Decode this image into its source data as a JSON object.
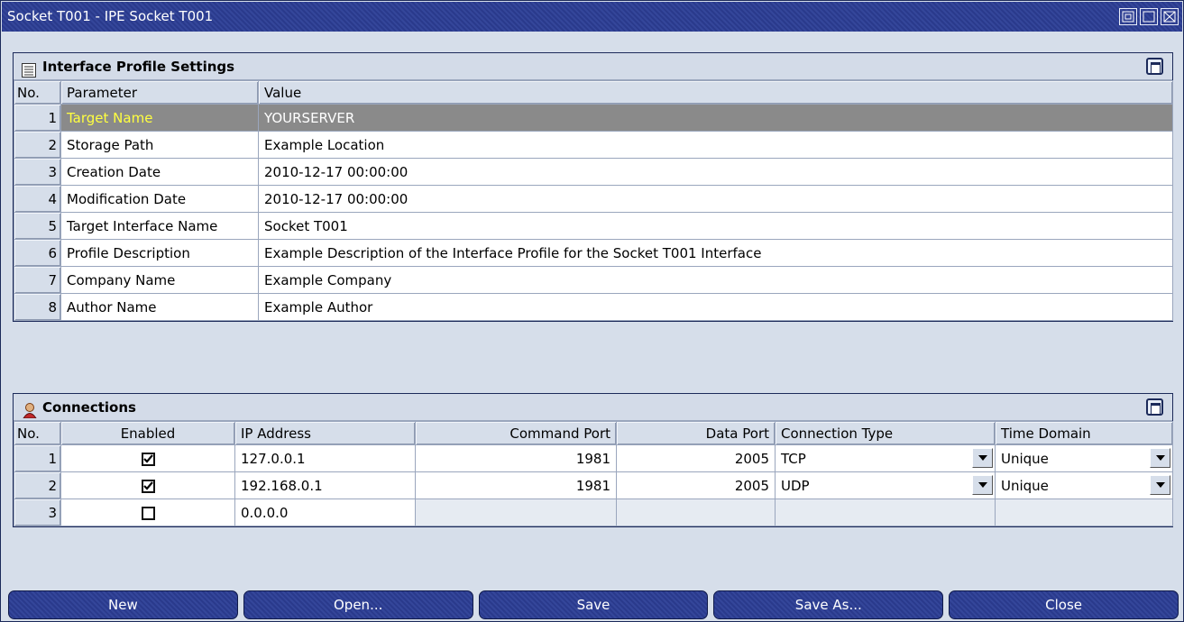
{
  "window": {
    "title": "Socket T001 - IPE Socket T001"
  },
  "profile": {
    "title": "Interface Profile Settings",
    "headers": {
      "no": "No.",
      "parameter": "Parameter",
      "value": "Value"
    },
    "rows": [
      {
        "no": "1",
        "parameter": "Target Name",
        "value": "YOURSERVER"
      },
      {
        "no": "2",
        "parameter": "Storage Path",
        "value": "Example Location"
      },
      {
        "no": "3",
        "parameter": "Creation Date",
        "value": "2010-12-17 00:00:00"
      },
      {
        "no": "4",
        "parameter": "Modification Date",
        "value": "2010-12-17 00:00:00"
      },
      {
        "no": "5",
        "parameter": "Target Interface Name",
        "value": "Socket T001"
      },
      {
        "no": "6",
        "parameter": "Profile Description",
        "value": "Example Description of the Interface Profile for the Socket T001 Interface"
      },
      {
        "no": "7",
        "parameter": "Company Name",
        "value": "Example Company"
      },
      {
        "no": "8",
        "parameter": "Author Name",
        "value": "Example Author"
      }
    ]
  },
  "connections": {
    "title": "Connections",
    "headers": {
      "no": "No.",
      "enabled": "Enabled",
      "ip": "IP Address",
      "command_port": "Command Port",
      "data_port": "Data Port",
      "connection_type": "Connection Type",
      "time_domain": "Time Domain"
    },
    "rows": [
      {
        "no": "1",
        "enabled": true,
        "ip": "127.0.0.1",
        "command_port": "1981",
        "data_port": "2005",
        "connection_type": "TCP",
        "time_domain": "Unique"
      },
      {
        "no": "2",
        "enabled": true,
        "ip": "192.168.0.1",
        "command_port": "1981",
        "data_port": "2005",
        "connection_type": "UDP",
        "time_domain": "Unique"
      },
      {
        "no": "3",
        "enabled": false,
        "ip": "0.0.0.0",
        "command_port": "",
        "data_port": "",
        "connection_type": "",
        "time_domain": ""
      }
    ]
  },
  "buttons": {
    "new": "New",
    "open": "Open...",
    "save": "Save",
    "save_as": "Save As...",
    "close": "Close"
  },
  "colors": {
    "title_bar": "#2a3a8c",
    "selected_row": "#8a8a8a",
    "selected_param": "#ffff40",
    "panel_bg": "#d6deea"
  },
  "icons": {
    "profile_header": "list-icon",
    "connections_header": "user-icon",
    "checkbox_checked": "checkmark-icon",
    "dropdown": "chevron-down-icon"
  }
}
